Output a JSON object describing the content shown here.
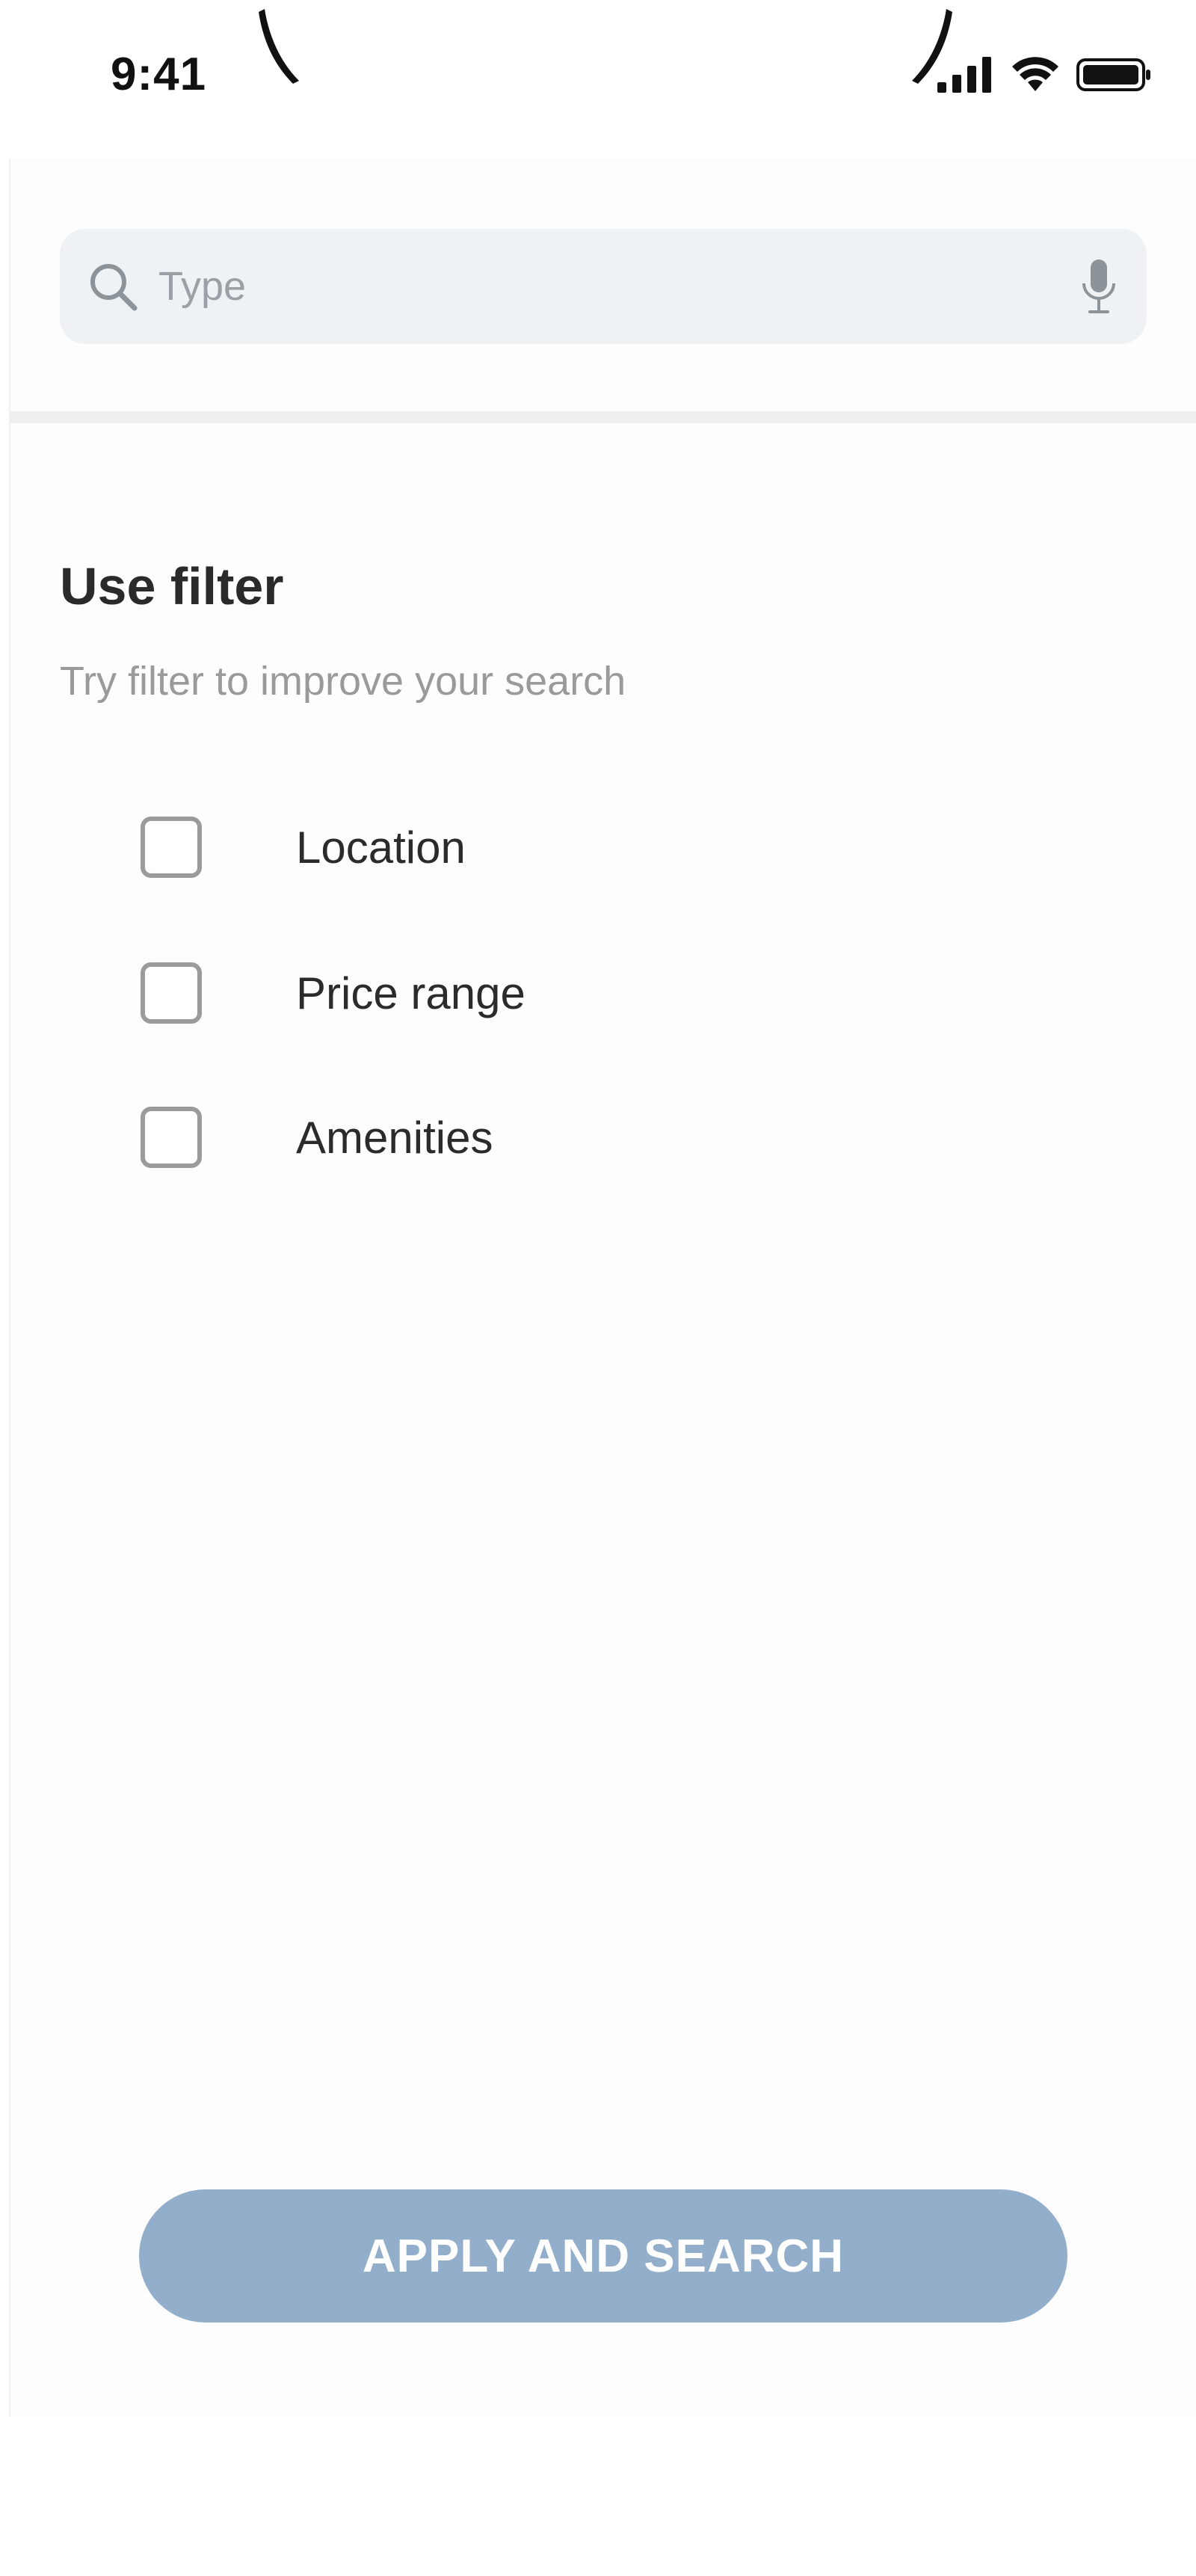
{
  "status_bar": {
    "time": "9:41"
  },
  "search": {
    "placeholder": "Type",
    "value": ""
  },
  "filter": {
    "title": "Use filter",
    "subtitle": "Try filter to improve your search",
    "options": [
      {
        "label": "Location",
        "checked": false
      },
      {
        "label": "Price range",
        "checked": false
      },
      {
        "label": "Amenities",
        "checked": false
      }
    ]
  },
  "apply_button": {
    "label": "APPLY AND SEARCH",
    "color": "#92aecb"
  },
  "icons": {
    "search": "search-icon",
    "mic": "microphone-icon",
    "signal": "cellular-signal-icon",
    "wifi": "wifi-icon",
    "battery": "battery-icon"
  }
}
